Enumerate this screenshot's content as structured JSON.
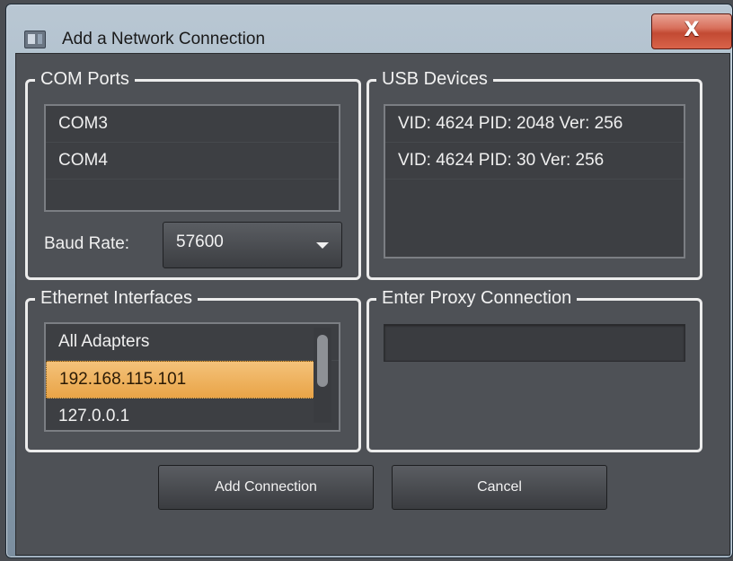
{
  "window": {
    "title": "Add a Network Connection",
    "close_symbol": "X"
  },
  "com_ports": {
    "label": "COM Ports",
    "items": [
      "COM3",
      "COM4"
    ],
    "baud_label": "Baud Rate:",
    "baud_value": "57600"
  },
  "usb_devices": {
    "label": "USB Devices",
    "items": [
      "VID: 4624 PID: 2048 Ver: 256",
      "VID: 4624 PID: 30 Ver: 256"
    ]
  },
  "ethernet": {
    "label": "Ethernet Interfaces",
    "items": [
      "All Adapters",
      "192.168.115.101",
      "127.0.0.1"
    ],
    "selected": "192.168.115.101"
  },
  "proxy": {
    "label": "Enter Proxy Connection",
    "value": ""
  },
  "buttons": {
    "add": "Add Connection",
    "cancel": "Cancel"
  },
  "icons": {
    "app": "window-app-icon",
    "close": "close-icon",
    "dropdown": "chevron-down-icon"
  },
  "colors": {
    "selection": "#e9a447",
    "close_button": "#c24a33"
  }
}
